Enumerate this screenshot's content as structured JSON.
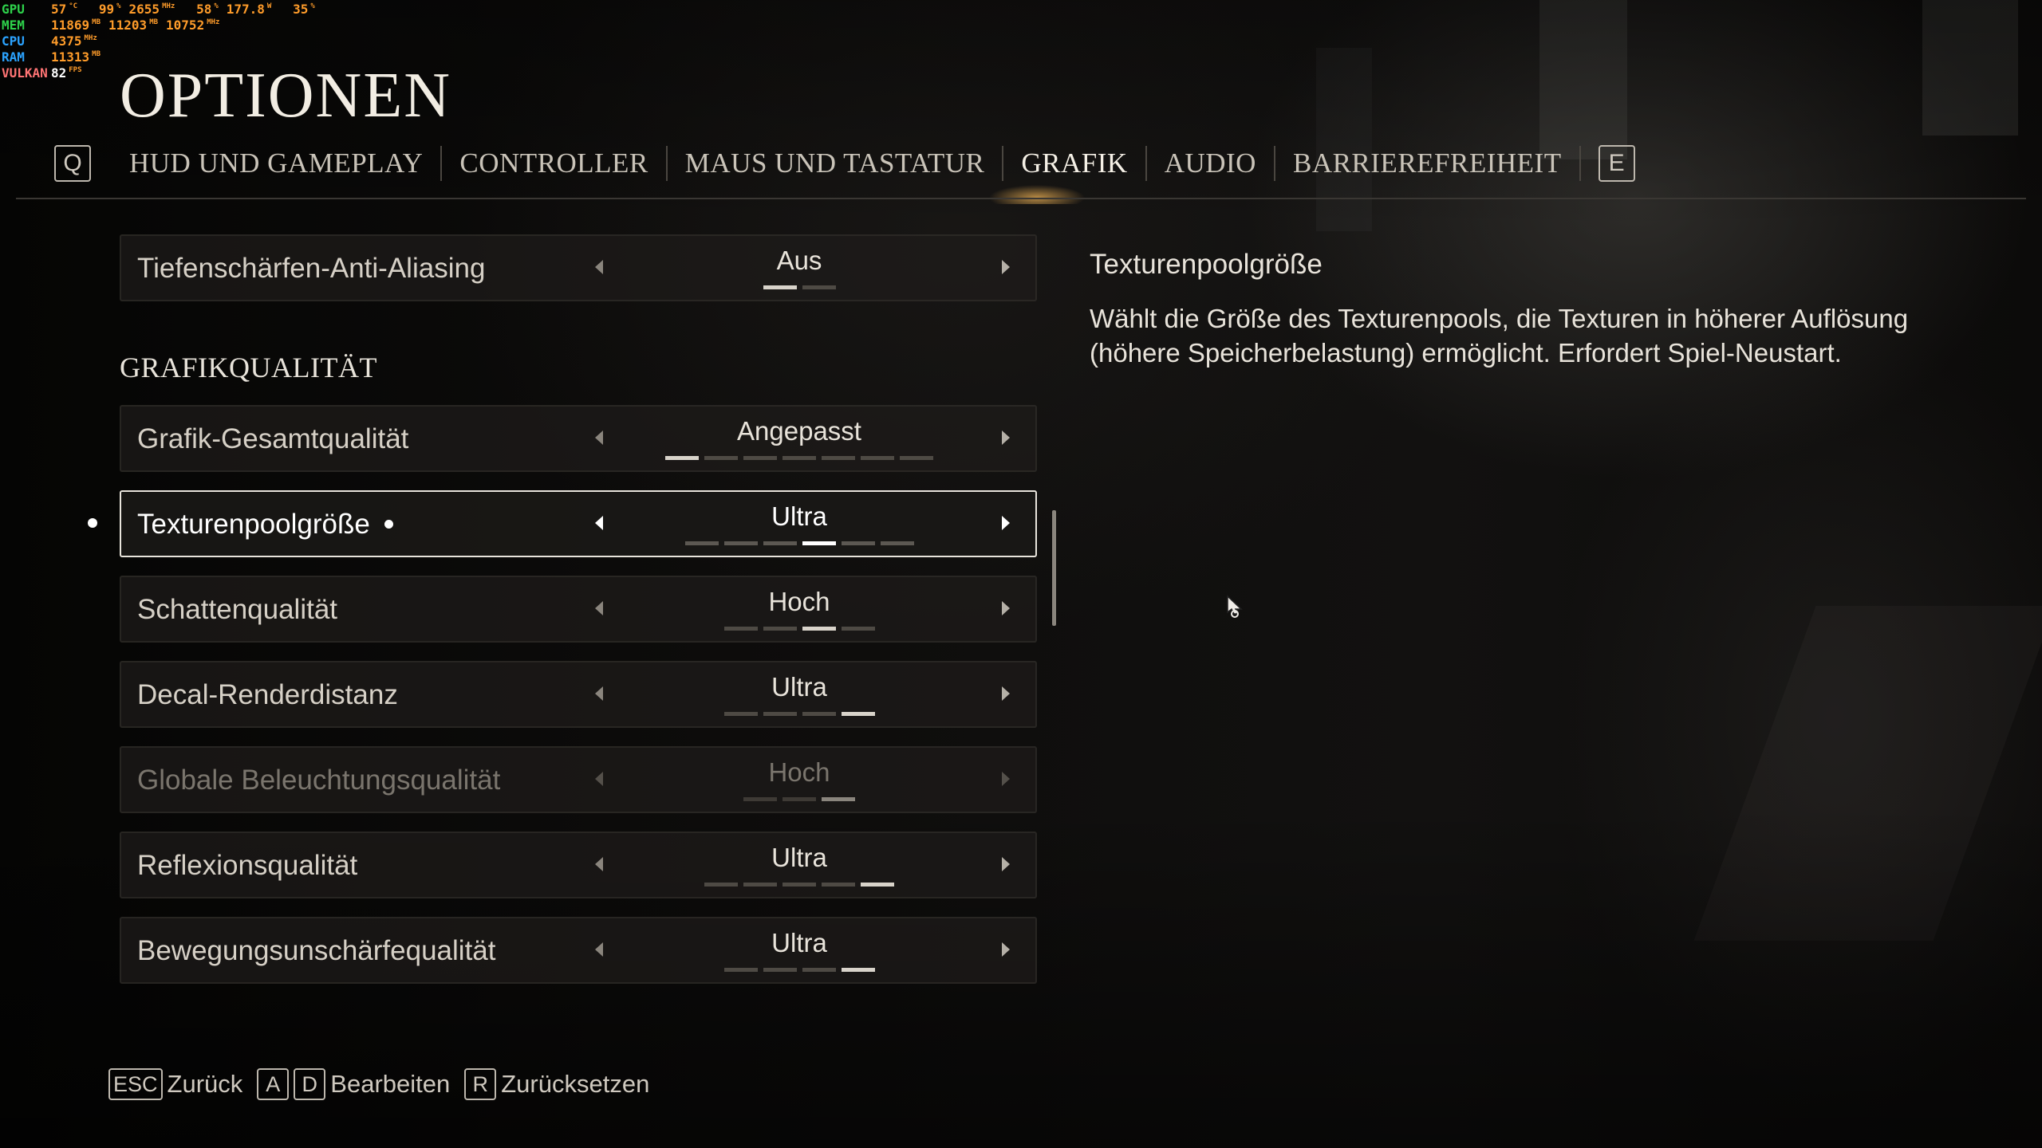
{
  "osd": {
    "gpu": {
      "label": "GPU",
      "values": [
        {
          "v": "57",
          "u": "°C"
        },
        {
          "v": "99",
          "u": "%"
        },
        {
          "v": "2655",
          "u": "MHz"
        },
        {
          "v": "58",
          "u": "%"
        },
        {
          "v": "177.8",
          "u": "W"
        },
        {
          "v": "35",
          "u": "%"
        }
      ]
    },
    "mem": {
      "label": "MEM",
      "values": [
        {
          "v": "11869",
          "u": "MB"
        },
        {
          "v": "11203",
          "u": "MB"
        },
        {
          "v": "10752",
          "u": "MHz"
        }
      ]
    },
    "cpu": {
      "label": "CPU",
      "values": [
        {
          "v": "4375",
          "u": "MHz"
        }
      ]
    },
    "ram": {
      "label": "RAM",
      "values": [
        {
          "v": "11313",
          "u": "MB"
        }
      ]
    },
    "vulkan": {
      "label": "VULKAN",
      "values": [
        {
          "v": "82",
          "u": "FPS"
        }
      ]
    }
  },
  "page_title": "OPTIONEN",
  "tabs": {
    "prev_key": "Q",
    "next_key": "E",
    "items": [
      {
        "label": "HUD UND GAMEPLAY",
        "active": false
      },
      {
        "label": "CONTROLLER",
        "active": false
      },
      {
        "label": "MAUS UND TASTATUR",
        "active": false
      },
      {
        "label": "GRAFIK",
        "active": true
      },
      {
        "label": "AUDIO",
        "active": false
      },
      {
        "label": "BARRIEREFREIHEIT",
        "active": false
      }
    ]
  },
  "settings_top": {
    "label": "Tiefenschärfen-Anti-Aliasing",
    "value": "Aus",
    "levels": 2,
    "level": 1
  },
  "section_title": "GRAFIKQUALITÄT",
  "settings": [
    {
      "label": "Grafik-Gesamtqualität",
      "value": "Angepasst",
      "levels": 7,
      "level": 1,
      "selected": false,
      "disabled": false
    },
    {
      "label": "Texturenpoolgröße",
      "value": "Ultra",
      "levels": 6,
      "level": 4,
      "selected": true,
      "disabled": false
    },
    {
      "label": "Schattenqualität",
      "value": "Hoch",
      "levels": 4,
      "level": 3,
      "selected": false,
      "disabled": false
    },
    {
      "label": "Decal-Renderdistanz",
      "value": "Ultra",
      "levels": 4,
      "level": 4,
      "selected": false,
      "disabled": false
    },
    {
      "label": "Globale Beleuchtungsqualität",
      "value": "Hoch",
      "levels": 3,
      "level": 3,
      "selected": false,
      "disabled": true
    },
    {
      "label": "Reflexionsqualität",
      "value": "Ultra",
      "levels": 5,
      "level": 5,
      "selected": false,
      "disabled": false
    },
    {
      "label": "Bewegungsunschärfequalität",
      "value": "Ultra",
      "levels": 4,
      "level": 4,
      "selected": false,
      "disabled": false
    }
  ],
  "description": {
    "title": "Texturenpoolgröße",
    "body": "Wählt die Größe des Texturenpools, die Texturen in höherer Auflösung (höhere Speicherbelastung) ermöglicht. Erfordert Spiel-Neustart."
  },
  "footer": [
    {
      "keys": [
        "ESC"
      ],
      "label": "Zurück"
    },
    {
      "keys": [
        "A",
        "D"
      ],
      "label": "Bearbeiten"
    },
    {
      "keys": [
        "R"
      ],
      "label": "Zurücksetzen"
    }
  ]
}
